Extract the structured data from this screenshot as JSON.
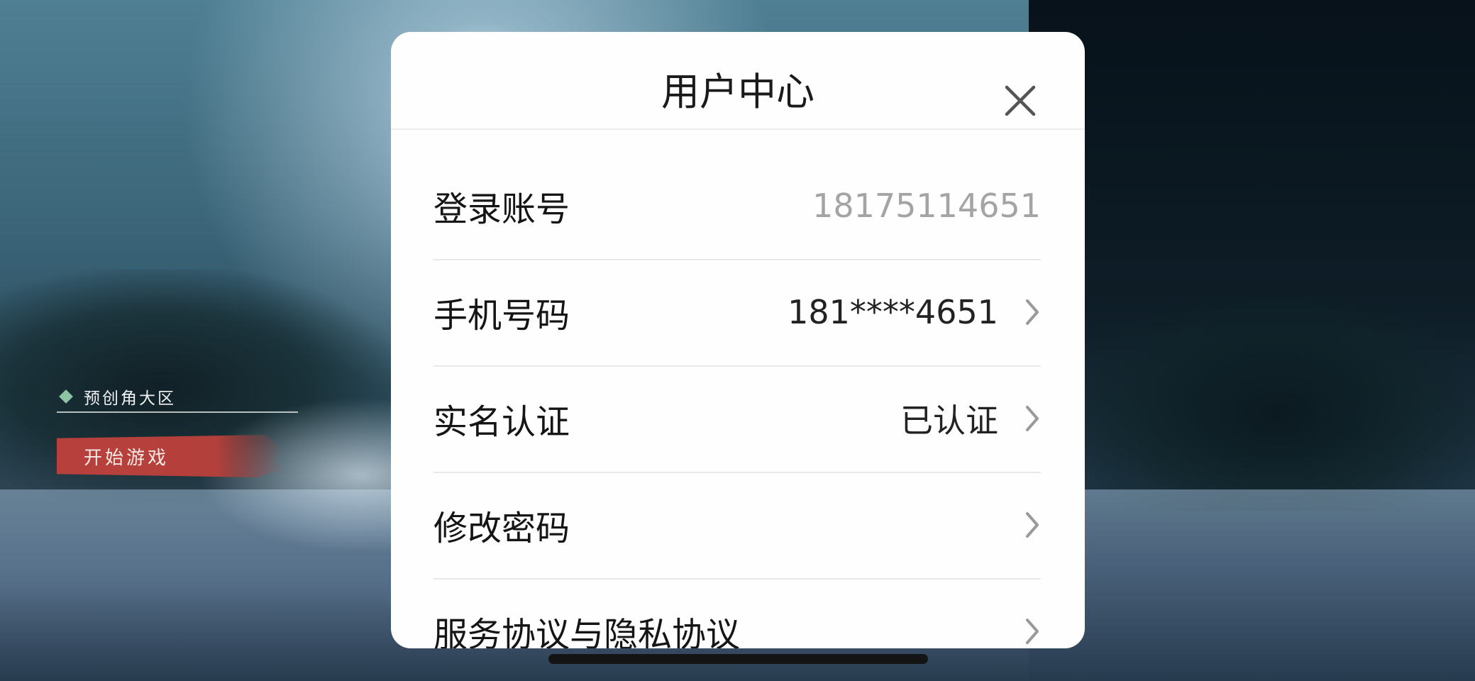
{
  "game": {
    "server_name": "预创角大区",
    "start_button": "开始游戏"
  },
  "user_center": {
    "title": "用户中心",
    "rows": [
      {
        "label": "登录账号",
        "value": "18175114651"
      },
      {
        "label": "手机号码",
        "value": "181****4651"
      },
      {
        "label": "实名认证",
        "value": "已认证"
      },
      {
        "label": "修改密码",
        "value": ""
      },
      {
        "label": "服务协议与隐私协议",
        "value": ""
      }
    ]
  },
  "icons": {
    "close": "close-icon",
    "chevron": "chevron-right-icon",
    "server_marker": "diamond-icon"
  },
  "colors": {
    "start_button": "#b8403c",
    "server_diamond": "#8fc3a5",
    "modal_background": "#fefefe",
    "value_muted": "#a4a4a4"
  }
}
